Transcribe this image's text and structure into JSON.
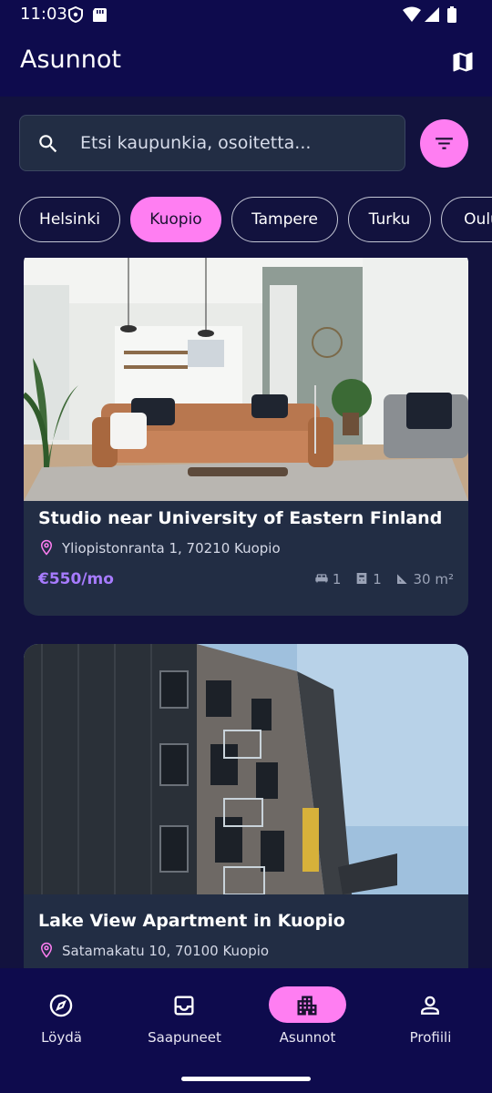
{
  "status_bar": {
    "time": "11:03",
    "icons_left": [
      "shield-icon",
      "sd-card-icon"
    ],
    "icons_right": [
      "wifi-icon",
      "signal-icon",
      "battery-icon"
    ]
  },
  "app_bar": {
    "title": "Asunnot",
    "map_icon": "map-icon"
  },
  "search": {
    "placeholder": "Etsi kaupunkia, osoitetta...",
    "value": "",
    "icon": "search-icon",
    "filter_icon": "filter-icon"
  },
  "city_chips": [
    {
      "label": "Helsinki",
      "selected": false
    },
    {
      "label": "Kuopio",
      "selected": true
    },
    {
      "label": "Tampere",
      "selected": false
    },
    {
      "label": "Turku",
      "selected": false
    },
    {
      "label": "Oulu",
      "selected": false
    }
  ],
  "listings": [
    {
      "title": "Studio near University of Eastern Finland",
      "address": "Yliopistonranta 1, 70210 Kuopio",
      "price": "€550/mo",
      "bedrooms": "1",
      "bathrooms": "1",
      "area": "30 m²",
      "photo": "living-room-photo"
    },
    {
      "title": "Lake View Apartment in Kuopio",
      "address": "Satamakatu 10, 70100 Kuopio",
      "photo": "apartment-building-photo"
    }
  ],
  "bottom_nav": [
    {
      "label": "Löydä",
      "icon": "compass-icon",
      "active": false
    },
    {
      "label": "Saapuneet",
      "icon": "inbox-icon",
      "active": false
    },
    {
      "label": "Asunnot",
      "icon": "apartment-icon",
      "active": true
    },
    {
      "label": "Profiili",
      "icon": "person-icon",
      "active": false
    }
  ],
  "colors": {
    "background": "#0e0b4d",
    "accent": "#ff7ef2",
    "card": "#222d44",
    "price": "#a77bff"
  }
}
